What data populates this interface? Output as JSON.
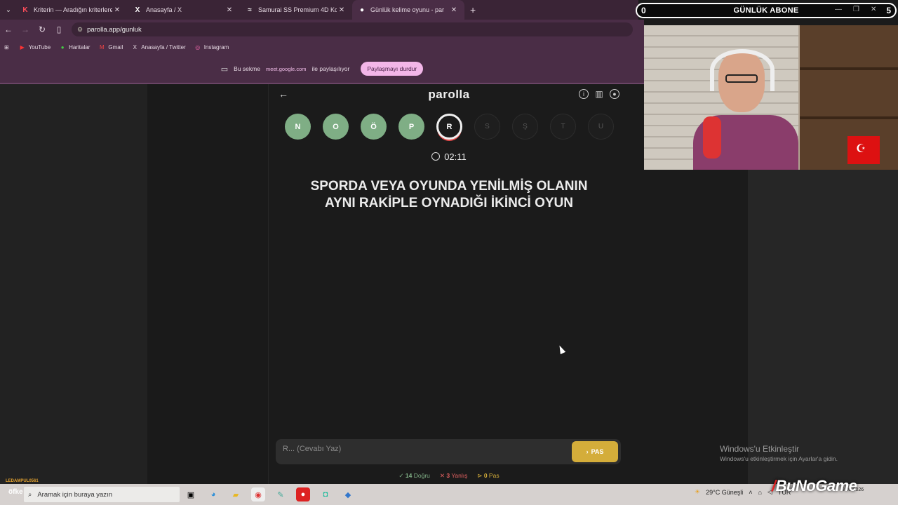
{
  "browser": {
    "tabs": [
      {
        "icon": "K",
        "title": "Kriterin — Aradığın kriterlere k"
      },
      {
        "icon": "X",
        "title": "Anasayfa / X"
      },
      {
        "icon": "≈",
        "title": "Samurai SS Premium 4D Kolçak"
      },
      {
        "icon": "●",
        "title": "Günlük kelime oyunu - par"
      }
    ],
    "url": "parolla.app/gunluk",
    "bookmarks": [
      "YouTube",
      "Haritalar",
      "Gmail",
      "Anasayfa / Twitter",
      "Instagram"
    ],
    "share": {
      "prefix": "Bu sekme",
      "site": "meet.google.com",
      "suffix": "ile paylaşılıyor",
      "stop": "Paylaşmayı durdur"
    }
  },
  "game": {
    "logo": "parolla",
    "letters": [
      {
        "ch": "N",
        "state": "correct"
      },
      {
        "ch": "O",
        "state": "correct"
      },
      {
        "ch": "Ö",
        "state": "correct"
      },
      {
        "ch": "P",
        "state": "correct"
      },
      {
        "ch": "R",
        "state": "active"
      },
      {
        "ch": "S",
        "state": "pending"
      },
      {
        "ch": "Ş",
        "state": "pending"
      },
      {
        "ch": "T",
        "state": "pending"
      },
      {
        "ch": "U",
        "state": "pending"
      }
    ],
    "timer": "02:11",
    "question": "SPORDA VEYA OYUNDA YENİLMİŞ OLANIN AYNI RAKİPLE OYNADIĞI İKİNCİ OYUN",
    "answer_placeholder": "R... (Cevabı Yaz)",
    "pass_label": "PAS",
    "stats": {
      "correct": "14",
      "correct_label": "Doğru",
      "wrong": "3",
      "wrong_label": "Yanlış",
      "pass": "0",
      "pass_label": "Pas"
    }
  },
  "overlay": {
    "abone_left": "0",
    "abone_title": "GÜNLÜK ABONE",
    "abone_right": "5",
    "brand": "BuNoGame"
  },
  "windows": {
    "activate_title": "Windows'u Etkinleştir",
    "activate_sub": "Windows'u etkinleştirmek için Ayarlar'a gidin.",
    "search_placeholder": "Aramak için buraya yazın",
    "weather": "29°C Güneşli",
    "lang": "TUR",
    "date": "3.08.2026",
    "lower_label": "LEDAMPUL0561",
    "ofke": "öfke"
  },
  "colors": {
    "correct": "#7fae85",
    "wrong": "#e06060",
    "pass": "#d4ad3a",
    "accent": "#f3b6e8"
  }
}
